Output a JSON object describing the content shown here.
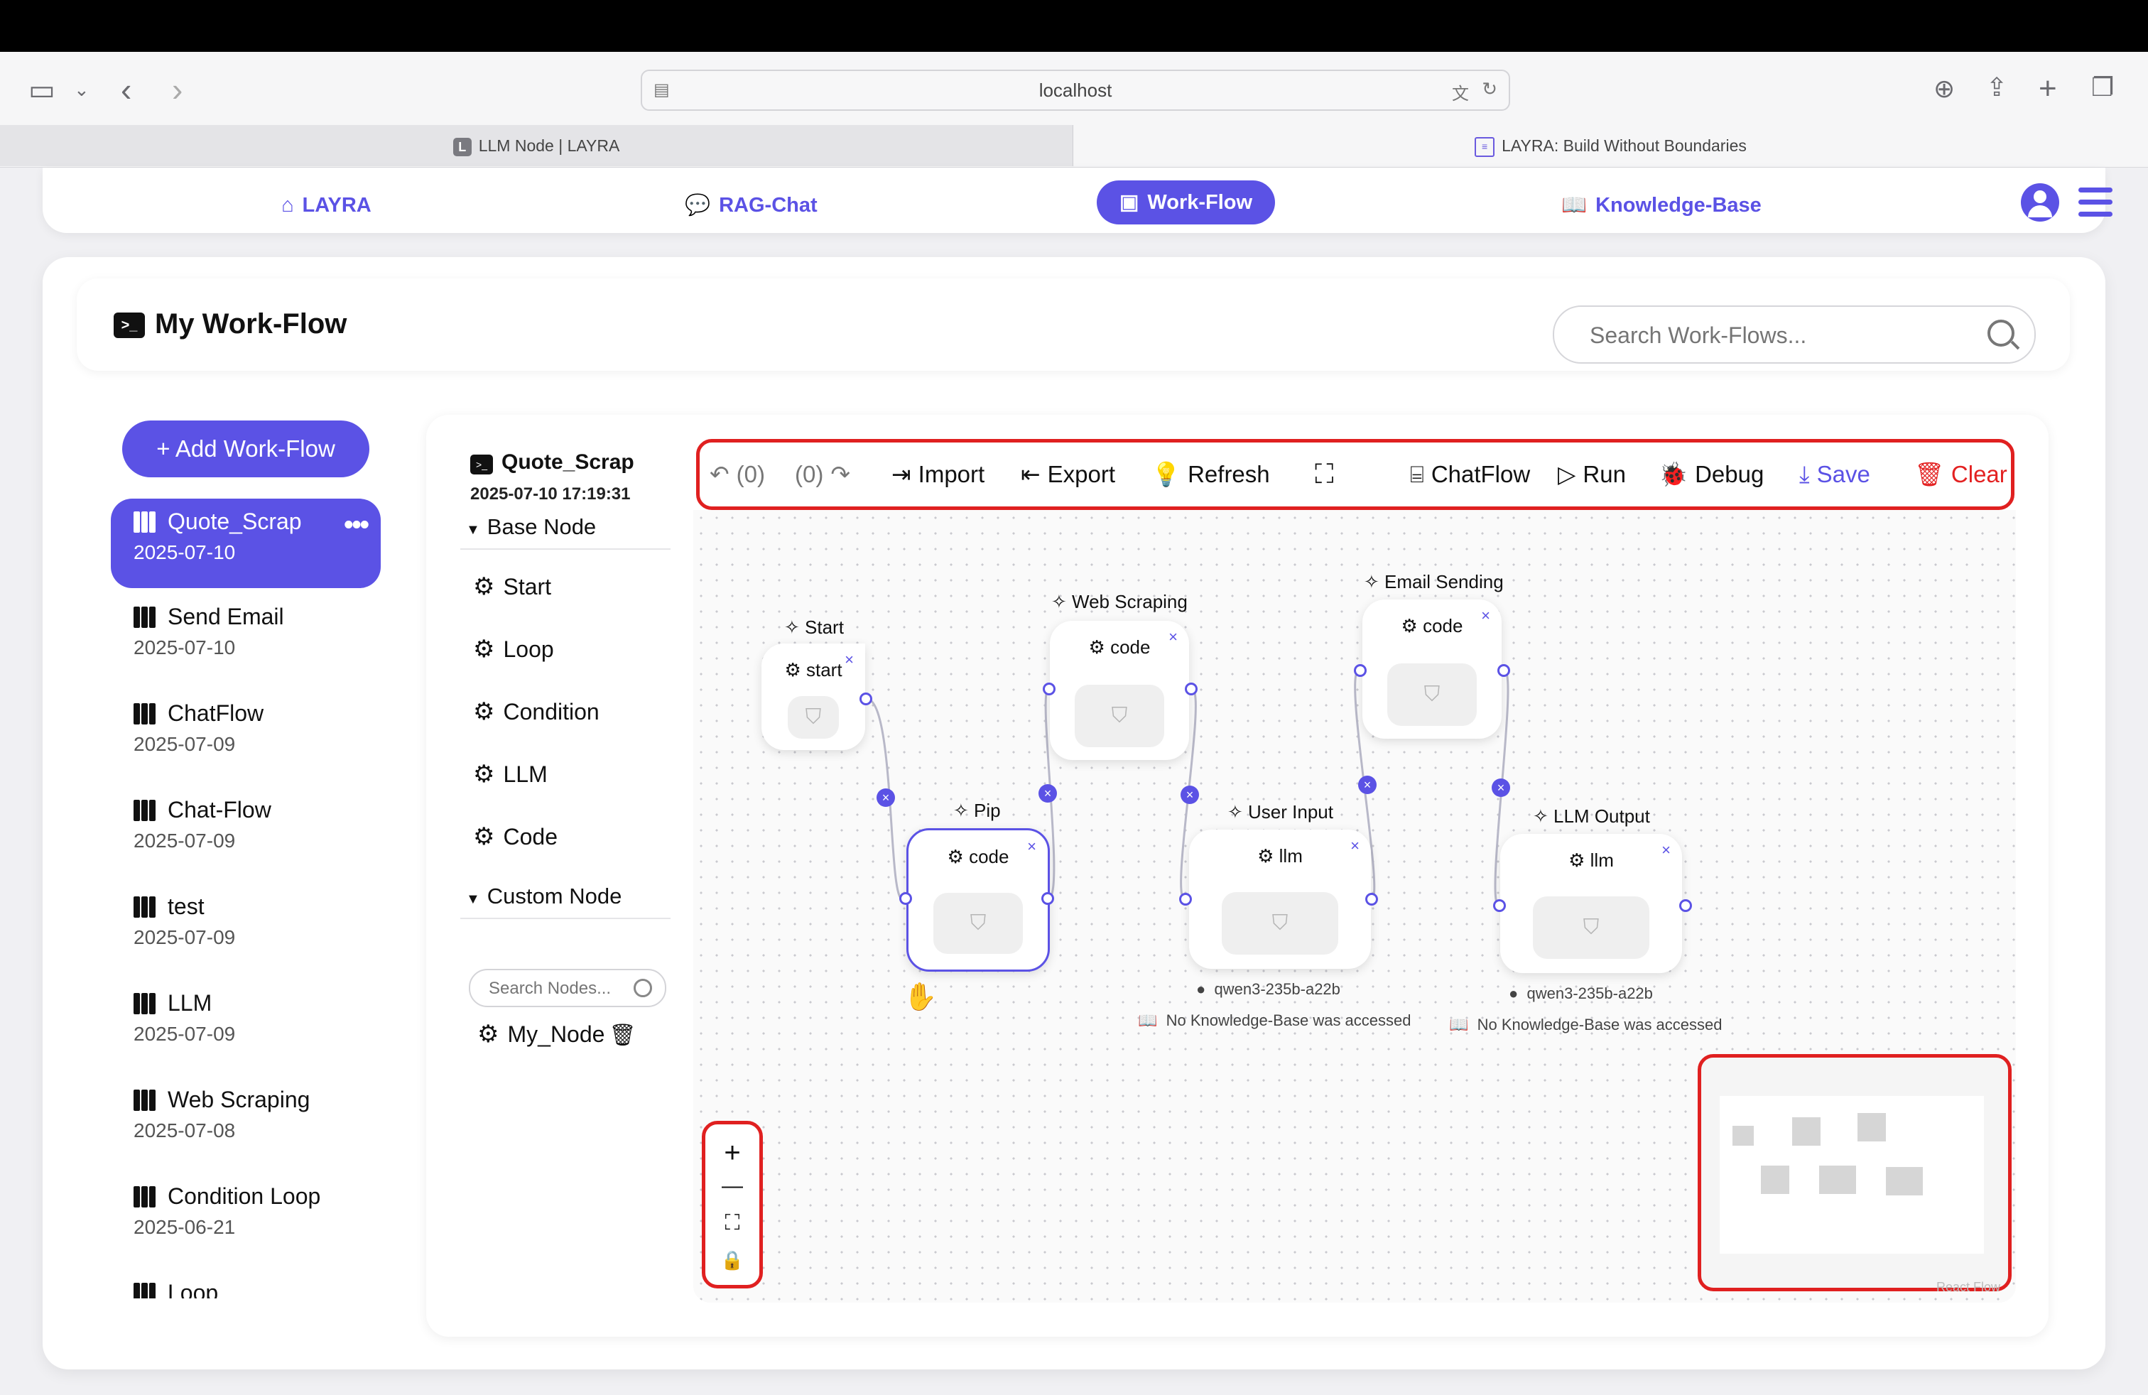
{
  "browser": {
    "url": "localhost",
    "tabs": [
      {
        "label": "LLM Node | LAYRA",
        "favicon": "L"
      },
      {
        "label": "LAYRA: Build Without Boundaries"
      }
    ]
  },
  "nav": {
    "items": [
      {
        "label": "LAYRA",
        "icon": "home-icon"
      },
      {
        "label": "RAG-Chat",
        "icon": "chat-icon"
      },
      {
        "label": "Work-Flow",
        "icon": "terminal-icon"
      },
      {
        "label": "Knowledge-Base",
        "icon": "book-icon"
      }
    ],
    "accent": "#5b52e5"
  },
  "header": {
    "title": "My Work-Flow",
    "search_placeholder": "Search Work-Flows..."
  },
  "sidebar": {
    "add_label": "+ Add Work-Flow",
    "items": [
      {
        "name": "Quote_Scrap",
        "date": "2025-07-10",
        "active": true
      },
      {
        "name": "Send Email",
        "date": "2025-07-10"
      },
      {
        "name": "ChatFlow",
        "date": "2025-07-09"
      },
      {
        "name": "Chat-Flow",
        "date": "2025-07-09"
      },
      {
        "name": "test",
        "date": "2025-07-09"
      },
      {
        "name": "LLM",
        "date": "2025-07-09"
      },
      {
        "name": "Web Scraping",
        "date": "2025-07-08"
      },
      {
        "name": "Condition Loop",
        "date": "2025-06-21"
      },
      {
        "name": "Loop",
        "date": ""
      }
    ]
  },
  "node_panel": {
    "title": "Quote_Scrap",
    "date": "2025-07-10 17:19:31",
    "base_section": "Base Node",
    "base_nodes": [
      "Start",
      "Loop",
      "Condition",
      "LLM",
      "Code"
    ],
    "custom_section": "Custom Node",
    "search_placeholder": "Search Nodes...",
    "custom_nodes": [
      "My_Node"
    ]
  },
  "toolbar": {
    "undo_count": "(0)",
    "redo_count": "(0)",
    "import": "Import",
    "export": "Export",
    "refresh": "Refresh",
    "chatflow": "ChatFlow",
    "run": "Run",
    "debug": "Debug",
    "save": "Save",
    "clear": "Clear"
  },
  "nodes": [
    {
      "title": "Start",
      "label": "start"
    },
    {
      "title": "Web Scraping",
      "label": "code"
    },
    {
      "title": "Email Sending",
      "label": "code"
    },
    {
      "title": "Pip",
      "label": "code",
      "selected": true
    },
    {
      "title": "User Input",
      "label": "llm",
      "model": "qwen3-235b-a22b",
      "kb": "No Knowledge-Base was accessed"
    },
    {
      "title": "LLM Output",
      "label": "llm",
      "model": "qwen3-235b-a22b",
      "kb": "No Knowledge-Base was accessed"
    }
  ],
  "controls": [
    "+",
    "—",
    "⛶",
    "🔒"
  ],
  "watermark": "React Flow"
}
